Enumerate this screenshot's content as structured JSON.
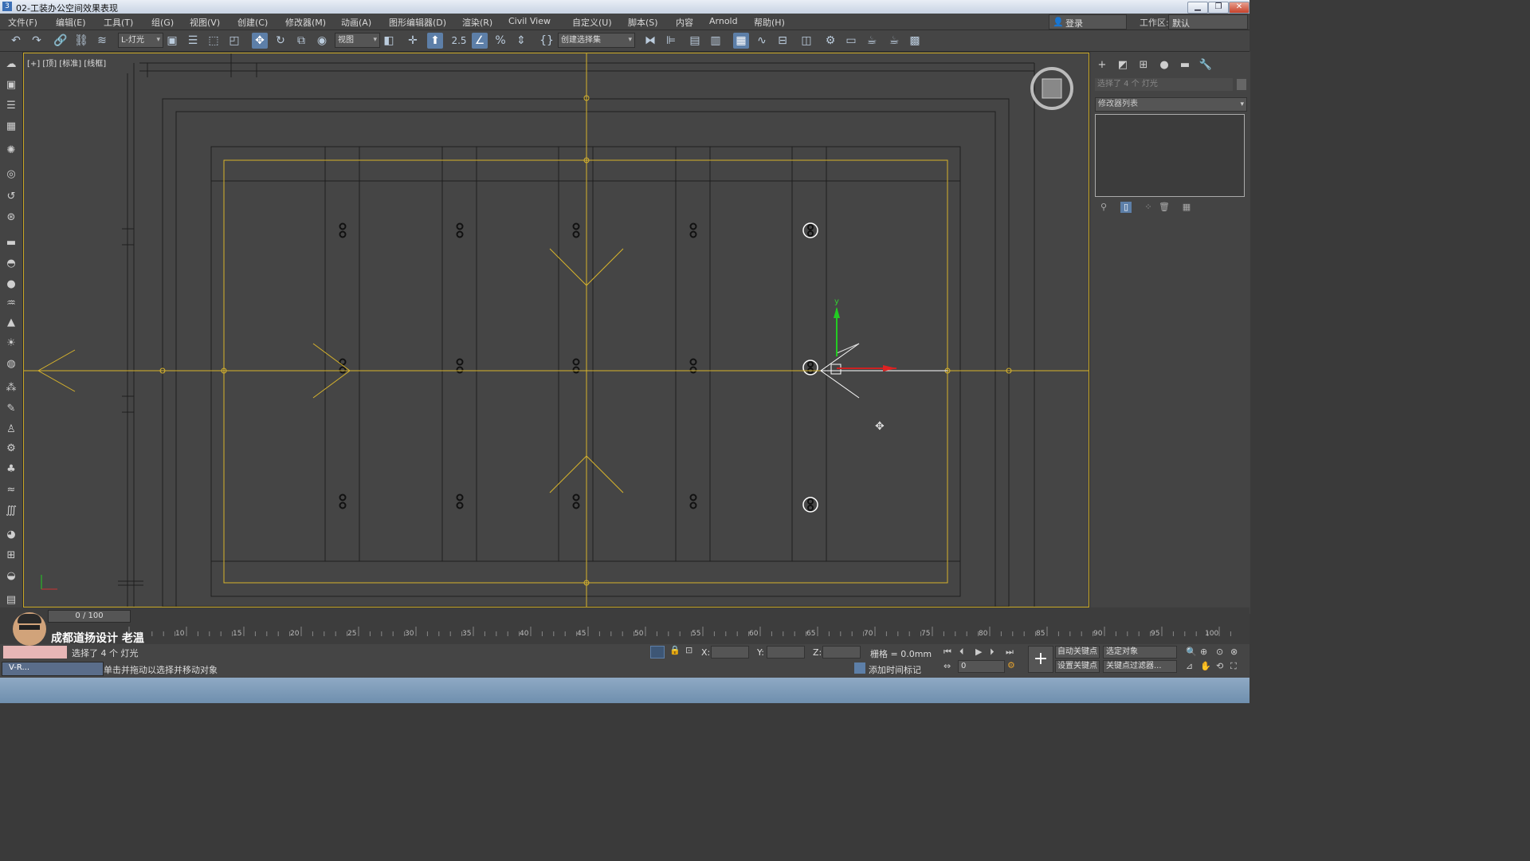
{
  "window": {
    "title": "02-工装办公空间效果表现",
    "app_icon": "3"
  },
  "menu": [
    "文件(F)",
    "编辑(E)",
    "工具(T)",
    "组(G)",
    "视图(V)",
    "创建(C)",
    "修改器(M)",
    "动画(A)",
    "图形编辑器(D)",
    "渲染(R)",
    "Civil View",
    "自定义(U)",
    "脚本(S)",
    "内容",
    "Arnold",
    "帮助(H)"
  ],
  "account": {
    "login": "登录",
    "workspace_label": "工作区:",
    "workspace_value": "默认"
  },
  "toolbar": {
    "selection_filter": "L-灯光",
    "ref_coord": "视图",
    "snap_label": "2.5",
    "named_selection": "创建选择集"
  },
  "viewport": {
    "label": "[+] [顶] [标准] [线框]"
  },
  "command_panel": {
    "selection_info": "选择了 4 个 灯光",
    "modifier_list": "修改器列表"
  },
  "timeline": {
    "slider": "0 / 100",
    "ticks": [
      "10",
      "15",
      "20",
      "25",
      "30",
      "35",
      "40",
      "45",
      "50",
      "55",
      "60",
      "65",
      "70",
      "75",
      "80",
      "85",
      "90",
      "95",
      "100"
    ]
  },
  "status": {
    "brand": "成都道扬设计 老温",
    "selected": "选择了 4 个 灯光",
    "prompt": "单击并拖动以选择并移动对象",
    "vr_button": "V-R...",
    "x_label": "X:",
    "y_label": "Y:",
    "z_label": "Z:",
    "grid": "栅格 = 0.0mm",
    "add_time_tag": "添加时间标记",
    "auto_key": "自动关键点",
    "set_key": "设置关键点",
    "selected_object": "选定对象",
    "key_filter": "关键点过滤器...",
    "frame": "0"
  }
}
